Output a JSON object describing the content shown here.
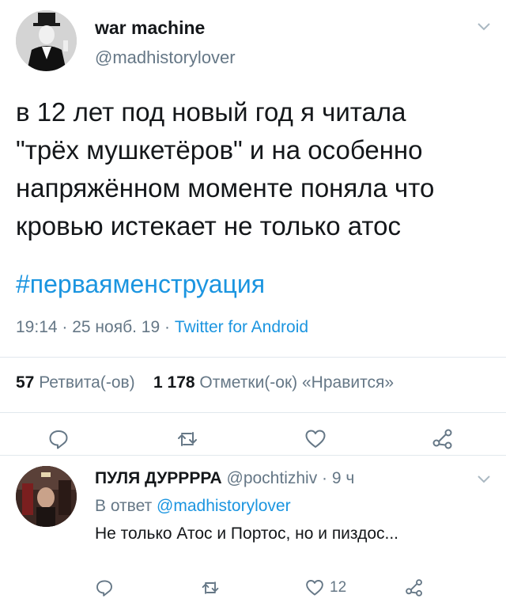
{
  "tweet": {
    "author_name": "war machine",
    "author_handle": "@madhistorylover",
    "text": "в 12 лет под новый год я читала\n\"трёх мушкетёров\" и на особенно\nнапряжённом моменте поняла что\nкровью истекает не только атос",
    "hashtag": "#перваяменструация",
    "time": "19:14",
    "date": "25 нояб. 19",
    "source": "Twitter for Android",
    "retweets_count": "57",
    "retweets_label": "Ретвита(-ов)",
    "likes_count": "1 178",
    "likes_label": "Отметки(-ок) «Нравится»"
  },
  "reply": {
    "author_name": "ПУЛЯ ДУРРРРА",
    "author_handle": "@pochtizhiv",
    "age": "9 ч",
    "reply_prefix": "В ответ",
    "reply_mention": "@madhistorylover",
    "text": "Не только Атос и Портос, но и пиздос...",
    "like_count": "12"
  },
  "icons": {
    "reply": "reply-icon",
    "retweet": "retweet-icon",
    "like": "heart-icon",
    "share": "share-icon",
    "more": "chevron-down-icon"
  },
  "colors": {
    "accent": "#1b95e0",
    "secondary_text": "#657786",
    "primary_text": "#14171a",
    "divider": "#e1e8ed"
  }
}
